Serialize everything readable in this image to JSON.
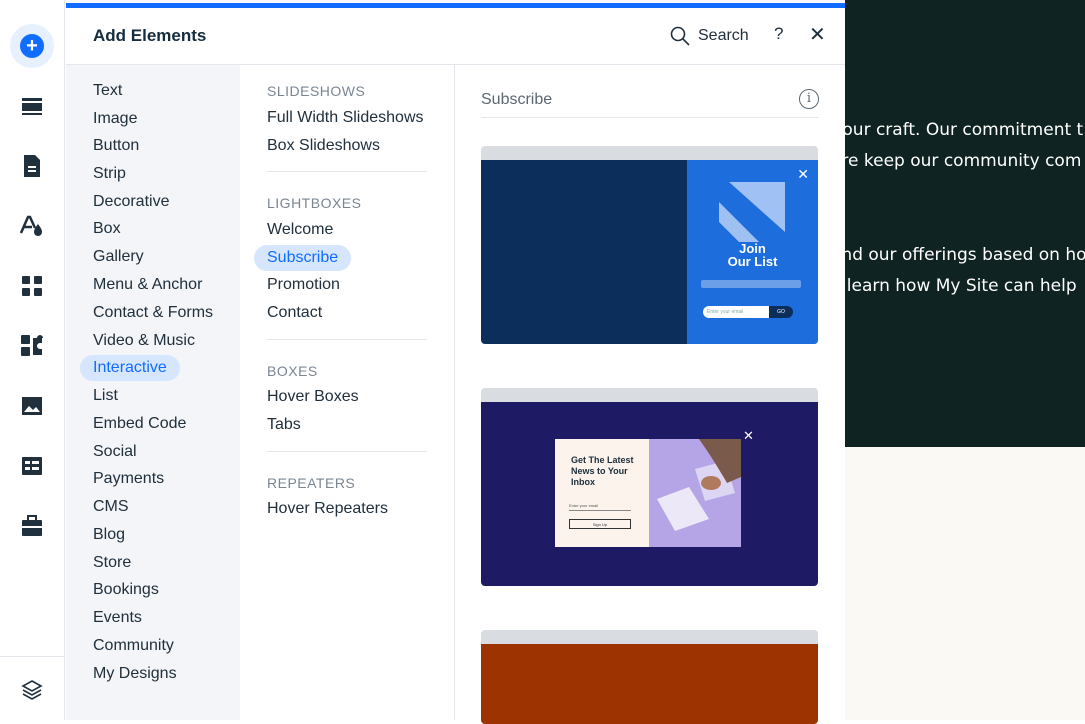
{
  "panel": {
    "title": "Add Elements",
    "search_label": "Search",
    "help_label": "?",
    "close_label": "✕"
  },
  "rail": {
    "items": [
      "add-icon",
      "sections-icon",
      "pages-icon",
      "design-icon",
      "apps-icon",
      "app-market-icon",
      "media-icon",
      "cms-icon",
      "business-icon",
      "layers-icon"
    ]
  },
  "categories": [
    "Text",
    "Image",
    "Button",
    "Strip",
    "Decorative",
    "Box",
    "Gallery",
    "Menu & Anchor",
    "Contact & Forms",
    "Video & Music",
    "Interactive",
    "List",
    "Embed Code",
    "Social",
    "Payments",
    "CMS",
    "Blog",
    "Store",
    "Bookings",
    "Events",
    "Community",
    "My Designs"
  ],
  "active_category": "Interactive",
  "sections": [
    {
      "title": "SLIDESHOWS",
      "items": [
        "Full Width Slideshows",
        "Box Slideshows"
      ]
    },
    {
      "title": "LIGHTBOXES",
      "items": [
        "Welcome",
        "Subscribe",
        "Promotion",
        "Contact"
      ]
    },
    {
      "title": "BOXES",
      "items": [
        "Hover Boxes",
        "Tabs"
      ]
    },
    {
      "title": "REPEATERS",
      "items": [
        "Hover Repeaters"
      ]
    }
  ],
  "active_item": "Subscribe",
  "preview": {
    "title": "Subscribe",
    "info_icon": "i",
    "card1": {
      "heading_line1": "Join",
      "heading_line2": "Our List",
      "input_placeholder": "Enter your email",
      "button": "GO",
      "close": "✕"
    },
    "card2": {
      "heading": "Get The Latest News to Your Inbox",
      "input_label": "Enter your email",
      "button": "Sign Up",
      "close": "✕"
    }
  },
  "site": {
    "line1": "f our craft. Our commitment t",
    "line2": "are keep our community com",
    "line3": "and our offerings based on ho",
    "line4": "o learn how My Site can help"
  },
  "colors": {
    "accent": "#116dff",
    "active_bg": "#d6e6fe",
    "site_dark": "#0f2422"
  }
}
